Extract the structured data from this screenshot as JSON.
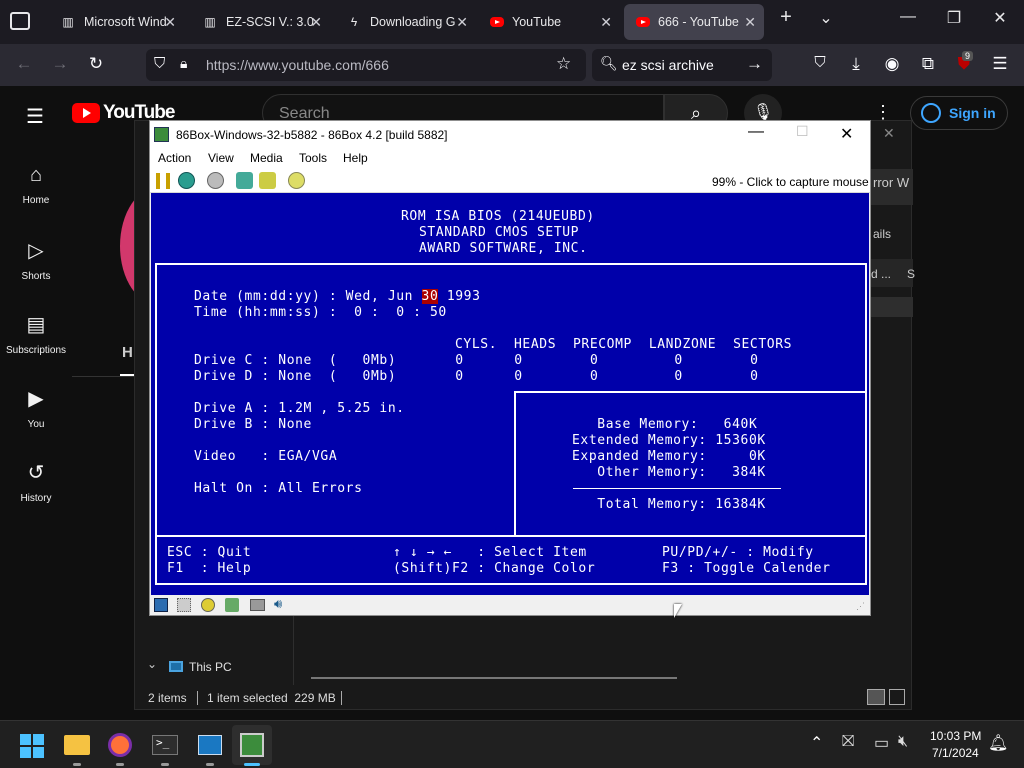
{
  "browser": {
    "tabs": [
      {
        "label": "Microsoft Wind",
        "icon": "file-icon"
      },
      {
        "label": "EZ-SCSI V.: 3.0",
        "icon": "file-icon"
      },
      {
        "label": "Downloading G",
        "icon": "lightning-icon"
      },
      {
        "label": "YouTube",
        "icon": "youtube-icon"
      },
      {
        "label": "666 - YouTube",
        "icon": "youtube-icon"
      }
    ],
    "url": "https://www.youtube.com/666",
    "search_query": "ez scsi archive",
    "extension_badge": "9"
  },
  "youtube": {
    "logo": "YouTube",
    "search_placeholder": "Search",
    "sign_in": "Sign in",
    "sidebar": [
      {
        "label": "Home"
      },
      {
        "label": "Shorts"
      },
      {
        "label": "Subscriptions"
      },
      {
        "label": "You"
      },
      {
        "label": "History"
      }
    ],
    "behind_text_1": "rror W",
    "behind_text_2": "ails",
    "behind_text_3": "d ...",
    "behind_text_4": "S",
    "behind_h": "H"
  },
  "explorer": {
    "tree_item": "This PC",
    "status_items": "2 items",
    "status_selected": "1 item selected  229 MB"
  },
  "emulator": {
    "title": "86Box-Windows-32-b5882 - 86Box 4.2 [build 5882]",
    "menu": [
      "Action",
      "View",
      "Media",
      "Tools",
      "Help"
    ],
    "capture_hint": "99% - Click to capture mouse",
    "bios": {
      "header": [
        "ROM ISA BIOS (214UEUBD)",
        "STANDARD CMOS SETUP",
        "AWARD SOFTWARE, INC."
      ],
      "date_label": "Date (mm:dd:yy) : Wed, Jun ",
      "date_day": "30",
      "date_year": " 1993",
      "time_line": "Time (hh:mm:ss) :  0 :  0 : 50",
      "drive_header": "CYLS.  HEADS  PRECOMP  LANDZONE  SECTORS",
      "drive_c": "Drive C : None  (   0Mb)       0      0        0         0        0",
      "drive_d": "Drive D : None  (   0Mb)       0      0        0         0        0",
      "drive_a": "Drive A : 1.2M , 5.25 in.",
      "drive_b": "Drive B : None",
      "video": "Video   : EGA/VGA",
      "halt": "Halt On : All Errors",
      "memory": [
        "   Base Memory:   640K",
        "Extended Memory: 15360K",
        "Expanded Memory:     0K",
        "   Other Memory:   384K"
      ],
      "total_memory": "   Total Memory: 16384K",
      "footer_left": "ESC : Quit\nF1  : Help",
      "footer_mid": "↑ ↓ → ←   : Select Item\n(Shift)F2 : Change Color",
      "footer_right": "PU/PD/+/- : Modify\nF3 : Toggle Calender"
    }
  },
  "taskbar": {
    "time": "10:03 PM",
    "date": "7/1/2024"
  }
}
